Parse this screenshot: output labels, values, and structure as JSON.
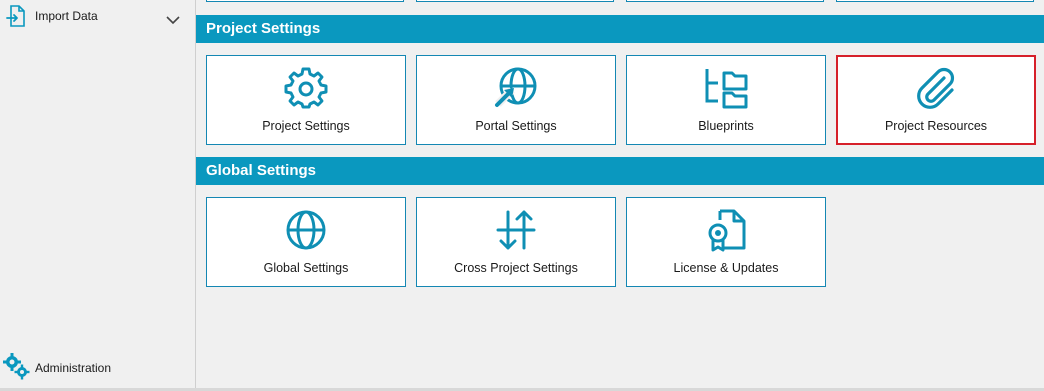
{
  "sidebar": {
    "import_data": "Import Data",
    "administration": "Administration"
  },
  "sections": {
    "project": {
      "title": "Project Settings",
      "tiles": [
        {
          "label": "Project Settings",
          "icon": "gear-icon"
        },
        {
          "label": "Portal Settings",
          "icon": "globe-arrow-icon"
        },
        {
          "label": "Blueprints",
          "icon": "folder-tree-icon"
        },
        {
          "label": "Project Resources",
          "icon": "paperclip-icon",
          "selected": true
        }
      ]
    },
    "global": {
      "title": "Global Settings",
      "tiles": [
        {
          "label": "Global Settings",
          "icon": "globe-icon"
        },
        {
          "label": "Cross Project Settings",
          "icon": "arrows-swap-icon"
        },
        {
          "label": "License & Updates",
          "icon": "license-icon"
        }
      ]
    }
  },
  "colors": {
    "accent": "#0a98bf",
    "tile_border": "#1487b3",
    "selected_border": "#d6202a"
  }
}
